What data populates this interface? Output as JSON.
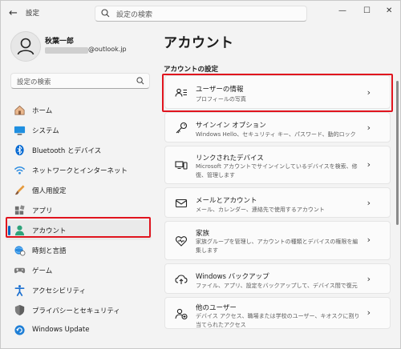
{
  "app": {
    "title": "設定"
  },
  "search": {
    "placeholder": "設定の検索"
  },
  "profile": {
    "name": "秋葉一郎",
    "email_suffix": "@outlook.jp"
  },
  "sidebar": {
    "items": [
      {
        "label": "ホーム",
        "icon": "home-icon"
      },
      {
        "label": "システム",
        "icon": "system-icon"
      },
      {
        "label": "Bluetooth とデバイス",
        "icon": "bluetooth-icon"
      },
      {
        "label": "ネットワークとインターネット",
        "icon": "wifi-icon"
      },
      {
        "label": "個人用設定",
        "icon": "brush-icon"
      },
      {
        "label": "アプリ",
        "icon": "apps-icon"
      },
      {
        "label": "アカウント",
        "icon": "account-icon",
        "selected": true
      },
      {
        "label": "時刻と言語",
        "icon": "globe-clock-icon"
      },
      {
        "label": "ゲーム",
        "icon": "gamepad-icon"
      },
      {
        "label": "アクセシビリティ",
        "icon": "accessibility-icon"
      },
      {
        "label": "プライバシーとセキュリティ",
        "icon": "shield-icon"
      },
      {
        "label": "Windows Update",
        "icon": "update-icon"
      }
    ]
  },
  "main": {
    "title": "アカウント",
    "section": "アカウントの設定",
    "cards": [
      {
        "title": "ユーザーの情報",
        "desc": "プロフィールの写真",
        "icon": "user-info-icon"
      },
      {
        "title": "サインイン オプション",
        "desc": "Windows Hello、セキュリティ キー、パスワード、動的ロック",
        "icon": "key-icon"
      },
      {
        "title": "リンクされたデバイス",
        "desc": "Microsoft アカウントでサインインしているデバイスを検索、修復、管理します",
        "icon": "linked-devices-icon"
      },
      {
        "title": "メールとアカウント",
        "desc": "メール、カレンダー、連絡先で使用するアカウント",
        "icon": "mail-icon"
      },
      {
        "title": "家族",
        "desc": "家族グループを管理し、アカウントの種類とデバイスの権限を編集します",
        "icon": "family-heart-icon"
      },
      {
        "title": "Windows バックアップ",
        "desc": "ファイル、アプリ、設定をバックアップして、デバイス間で復元",
        "icon": "backup-icon"
      },
      {
        "title": "他のユーザー",
        "desc": "デバイス アクセス、職場または学校のユーザー、キオスクに割り当てられたアクセス",
        "icon": "other-users-icon"
      }
    ]
  },
  "colors": {
    "accent": "#0067c0",
    "highlight": "#e0141e"
  }
}
